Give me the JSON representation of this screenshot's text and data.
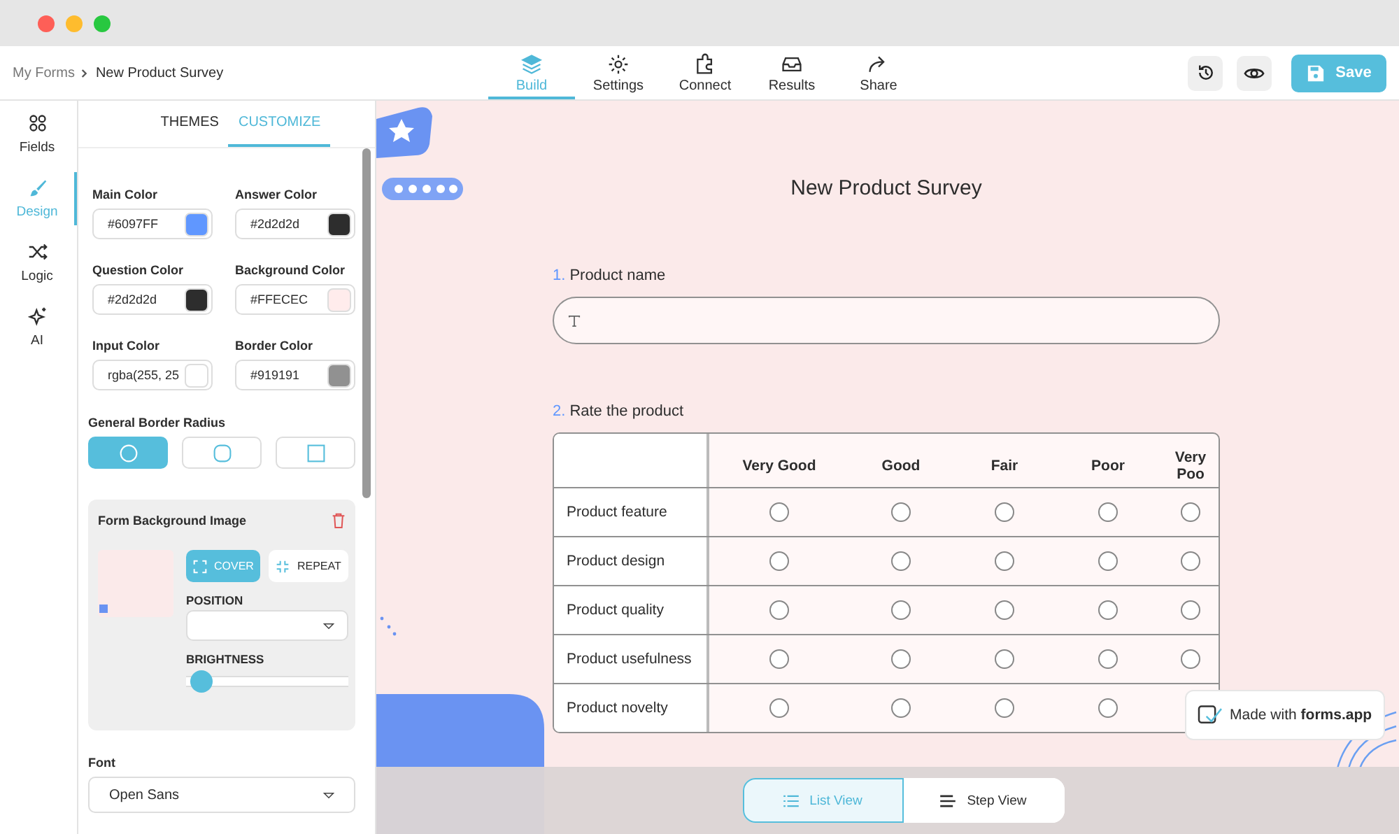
{
  "breadcrumb": [
    {
      "label": "My Forms"
    },
    {
      "label": "New Product Survey"
    }
  ],
  "nav_tabs": [
    {
      "label": "Build",
      "kind": "layers",
      "selected": true
    },
    {
      "label": "Settings",
      "kind": "gear",
      "selected": false
    },
    {
      "label": "Connect",
      "kind": "puzzle",
      "selected": false
    },
    {
      "label": "Results",
      "kind": "inbox",
      "selected": false
    },
    {
      "label": "Share",
      "kind": "share",
      "selected": false
    }
  ],
  "save_label": "Save",
  "rail": [
    {
      "label": "Fields",
      "kind": "grid",
      "selected": false
    },
    {
      "label": "Design",
      "kind": "brush",
      "selected": true
    },
    {
      "label": "Logic",
      "kind": "shuffle",
      "selected": false
    },
    {
      "label": "AI",
      "kind": "sparkle",
      "selected": false
    }
  ],
  "panel_tabs": [
    {
      "label": "THEMES",
      "selected": false
    },
    {
      "label": "CUSTOMIZE",
      "selected": true
    }
  ],
  "color_fields": [
    {
      "label": "Main Color",
      "value": "#6097FF",
      "color": "#6097ff"
    },
    {
      "label": "Answer Color",
      "value": "#2d2d2d",
      "color": "#2d2d2d"
    },
    {
      "label": "Question Color",
      "value": "#2d2d2d",
      "color": "#2d2d2d"
    },
    {
      "label": "Background Color",
      "value": "#FFECEC",
      "color": "#ffecec"
    },
    {
      "label": "Input Color",
      "value": "rgba(255, 25",
      "color": "#ffffff"
    },
    {
      "label": "Border Color",
      "value": "#919191",
      "color": "#919191"
    }
  ],
  "border_radius": {
    "label": "General Border Radius",
    "options": [
      {
        "kind": "round",
        "selected": true
      },
      {
        "kind": "soft",
        "selected": false
      },
      {
        "kind": "square",
        "selected": false
      }
    ]
  },
  "background_image": {
    "title": "Form Background Image",
    "modes": [
      {
        "label": "COVER",
        "kind": "cover",
        "selected": true
      },
      {
        "label": "REPEAT",
        "kind": "repeat",
        "selected": false
      }
    ],
    "position_label": "POSITION",
    "brightness_label": "BRIGHTNESS",
    "brightness": {
      "level": 0.03
    }
  },
  "font": {
    "label": "Font",
    "value": "Open Sans"
  },
  "form": {
    "title": "New Product Survey",
    "questions": [
      {
        "kind": "text",
        "number": "1.",
        "label": "Product name"
      },
      {
        "kind": "matrix",
        "number": "2.",
        "label": "Rate the product",
        "columns": [
          "Very Good",
          "Good",
          "Fair",
          "Poor",
          "Very Poo"
        ],
        "rows": [
          {
            "label": "Product feature",
            "answers": [
              {
                "selected": false
              },
              {
                "selected": false
              },
              {
                "selected": false
              },
              {
                "selected": false
              },
              {
                "selected": false
              }
            ]
          },
          {
            "label": "Product design",
            "answers": [
              {
                "selected": false
              },
              {
                "selected": false
              },
              {
                "selected": false
              },
              {
                "selected": false
              },
              {
                "selected": false
              }
            ]
          },
          {
            "label": "Product quality",
            "answers": [
              {
                "selected": false
              },
              {
                "selected": false
              },
              {
                "selected": false
              },
              {
                "selected": false
              },
              {
                "selected": false
              }
            ]
          },
          {
            "label": "Product usefulness",
            "answers": [
              {
                "selected": false
              },
              {
                "selected": false
              },
              {
                "selected": false
              },
              {
                "selected": false
              },
              {
                "selected": false
              }
            ]
          },
          {
            "label": "Product novelty",
            "answers": [
              {
                "selected": false
              },
              {
                "selected": false
              },
              {
                "selected": false
              },
              {
                "selected": false
              }
            ]
          }
        ]
      }
    ]
  },
  "badge": "Made with **forms.app**",
  "view_toggle": [
    {
      "label": "List View",
      "kind": "list",
      "selected": true
    },
    {
      "label": "Step View",
      "kind": "step",
      "selected": false
    }
  ]
}
